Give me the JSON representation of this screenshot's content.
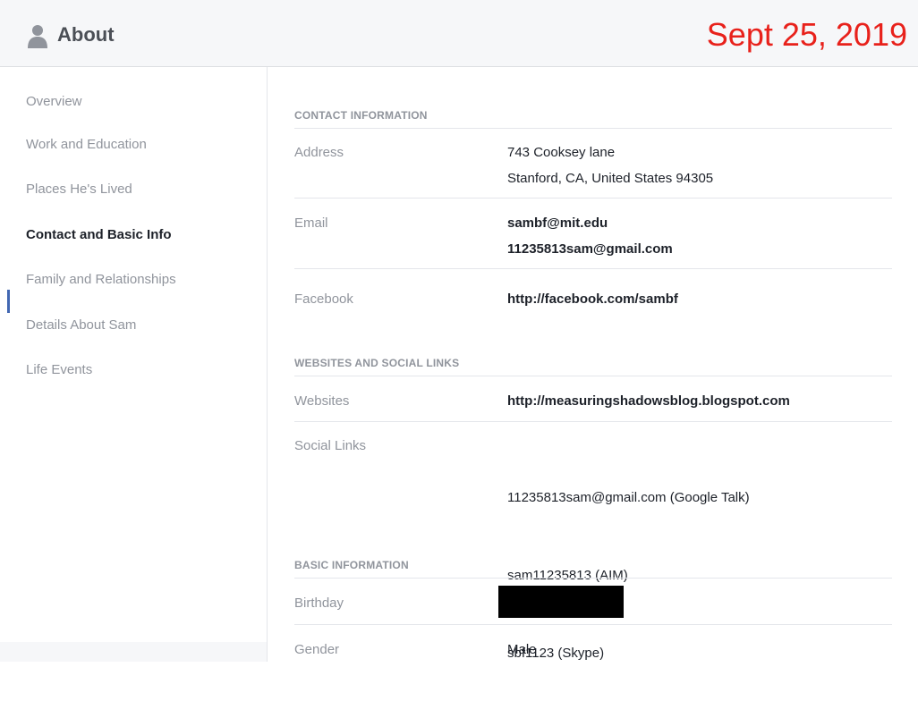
{
  "header": {
    "title": "About",
    "date_stamp": "Sept 25, 2019",
    "icon": "person-icon"
  },
  "sidebar": {
    "items": [
      {
        "label": "Overview",
        "active": false
      },
      {
        "label": "Work and Education",
        "active": false
      },
      {
        "label": "Places He's Lived",
        "active": false
      },
      {
        "label": "Contact and Basic Info",
        "active": true
      },
      {
        "label": "Family and Relationships",
        "active": false
      },
      {
        "label": "Details About Sam",
        "active": false
      },
      {
        "label": "Life Events",
        "active": false
      }
    ]
  },
  "contact": {
    "heading": "CONTACT INFORMATION",
    "address_label": "Address",
    "address_lines": [
      "743 Cooksey lane",
      "Stanford, CA, United States 94305"
    ],
    "email_label": "Email",
    "emails": [
      "sambf@mit.edu",
      "11235813sam@gmail.com"
    ],
    "facebook_label": "Facebook",
    "facebook_value": "http://facebook.com/sambf"
  },
  "websites": {
    "heading": "WEBSITES AND SOCIAL LINKS",
    "websites_label": "Websites",
    "websites_value": "http://measuringshadowsblog.blogspot.com",
    "social_label": "Social Links",
    "social_links": [
      "11235813sam@gmail.com  (Google Talk)",
      "sam11235813  (AIM)",
      "sbf1123  (Skype)"
    ]
  },
  "basic": {
    "heading": "BASIC INFORMATION",
    "birthday_label": "Birthday",
    "gender_label": "Gender",
    "gender_value": "Male"
  }
}
